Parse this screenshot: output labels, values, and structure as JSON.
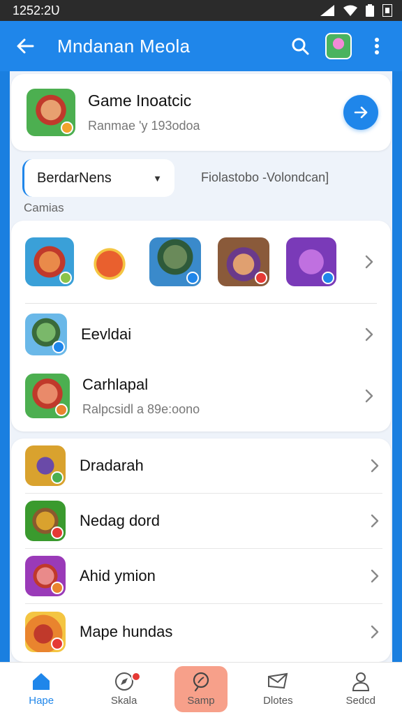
{
  "status_bar": {
    "time": "1252:2Ʋ"
  },
  "app_bar": {
    "title": "Mndanan Meola"
  },
  "featured": {
    "name": "Game Inoatcic",
    "subtitle": "Ranmae 'y 193odoa"
  },
  "filter": {
    "dropdown_value": "BerdarNens",
    "label": "Fiolastobo -Volondcan]"
  },
  "section": {
    "title": "Camias"
  },
  "group1": {
    "icon_strip": [
      {
        "icon": "red-hat-character",
        "color": "#3aa0d8"
      },
      {
        "icon": "orange-dragon",
        "color": "#ffffff"
      },
      {
        "icon": "green-warrior",
        "color": "#3a8a4a"
      },
      {
        "icon": "cowboy-hat-character",
        "color": "#8a5a3a"
      },
      {
        "icon": "purple-witch",
        "color": "#7a3ab8"
      }
    ],
    "rows": [
      {
        "label": "Eevldai",
        "sublabel": ""
      },
      {
        "label": "Carhlapal",
        "sublabel": "Ralpcsidl a 89e:oono"
      }
    ]
  },
  "group2": {
    "rows": [
      {
        "label": "Dradarah",
        "icon_color": "#d9a22e"
      },
      {
        "label": "Nedag dord",
        "icon_color": "#3a9a2e"
      },
      {
        "label": "Ahid ymion",
        "icon_color": "#9a3ab8"
      },
      {
        "label": "Mape hundas",
        "icon_color": "#e9842e"
      }
    ]
  },
  "bottom_nav": [
    {
      "label": "Hape",
      "icon": "home-icon"
    },
    {
      "label": "Skala",
      "icon": "compass-icon"
    },
    {
      "label": "Samp",
      "icon": "search-icon"
    },
    {
      "label": "Dlotes",
      "icon": "message-icon"
    },
    {
      "label": "Sedcd",
      "icon": "person-icon"
    }
  ],
  "colors": {
    "primary": "#1f86ea",
    "highlight": "#f7a08a",
    "badge": "#e53935"
  }
}
